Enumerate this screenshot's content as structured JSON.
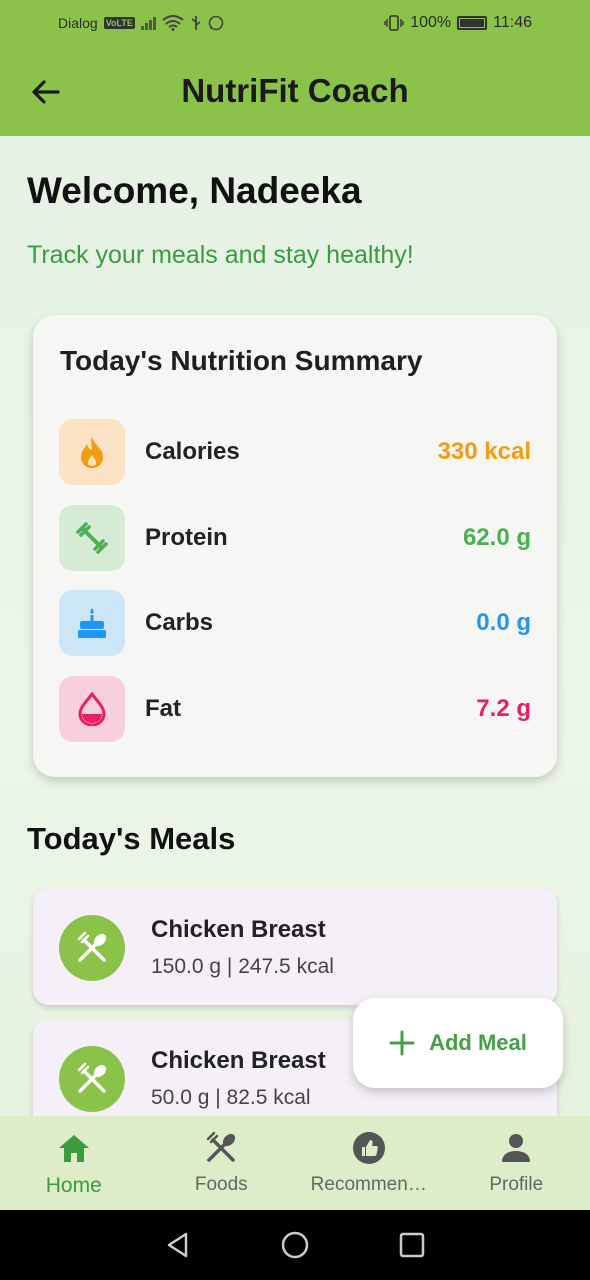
{
  "status_bar": {
    "carrier": "Dialog",
    "volte": "VoLTE",
    "battery": "100%",
    "time": "11:46"
  },
  "app_bar": {
    "title": "NutriFit Coach",
    "back_icon": "arrow-left-icon"
  },
  "welcome": {
    "greeting": "Welcome, Nadeeka",
    "tagline": "Track your meals and stay healthy!"
  },
  "summary": {
    "title": "Today's Nutrition Summary",
    "items": [
      {
        "label": "Calories",
        "value": "330 kcal",
        "icon": "fire-icon",
        "color": "#f39c12",
        "bg": "#fce3c6"
      },
      {
        "label": "Protein",
        "value": "62.0 g",
        "icon": "dumbbell-icon",
        "color": "#4caf50",
        "bg": "#d5ebd4"
      },
      {
        "label": "Carbs",
        "value": "0.0 g",
        "icon": "cake-icon",
        "color": "#2196f3",
        "bg": "#cde6f7"
      },
      {
        "label": "Fat",
        "value": "7.2 g",
        "icon": "drop-icon",
        "color": "#e91e63",
        "bg": "#f8cfdc"
      }
    ]
  },
  "meals": {
    "title": "Today's Meals",
    "items": [
      {
        "name": "Chicken Breast",
        "detail": "150.0 g | 247.5 kcal",
        "icon": "utensils-icon"
      },
      {
        "name": "Chicken Breast",
        "detail": "50.0 g | 82.5 kcal",
        "icon": "utensils-icon"
      }
    ]
  },
  "fab": {
    "label": "Add Meal",
    "icon": "plus-icon"
  },
  "bottom_nav": {
    "items": [
      {
        "label": "Home",
        "icon": "home-icon",
        "active": true
      },
      {
        "label": "Foods",
        "icon": "utensils-icon",
        "active": false
      },
      {
        "label": "Recommen…",
        "icon": "thumbs-up-icon",
        "active": false
      },
      {
        "label": "Profile",
        "icon": "person-icon",
        "active": false
      }
    ]
  },
  "colors": {
    "primary": "#8bc34a",
    "accent_green": "#3c9a3f"
  }
}
